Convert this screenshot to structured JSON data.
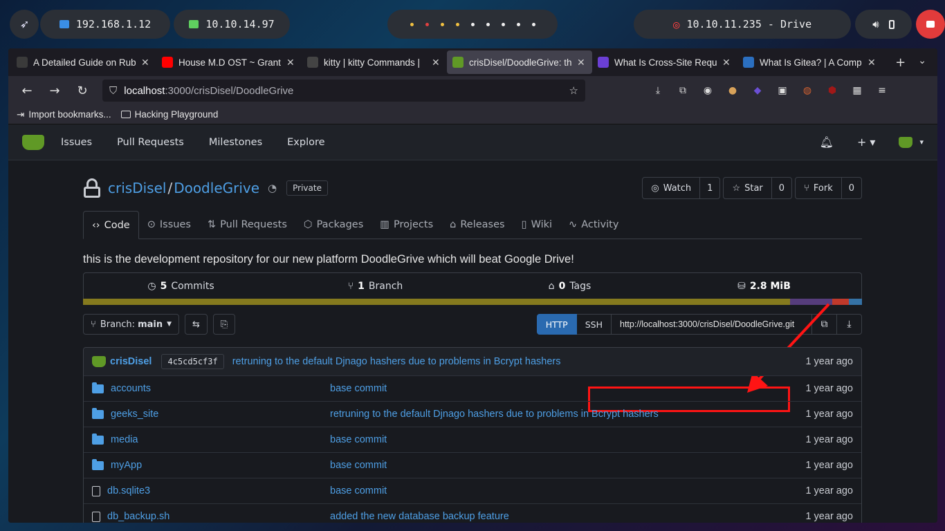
{
  "desktop": {
    "ip_local": "192.168.1.12",
    "ip_vpn": "10.10.14.97",
    "target": "10.10.11.235 - Drive",
    "workspace_dot_colors": [
      "#f0c040",
      "#e04040",
      "#f0c040",
      "#f0c040",
      "#eeeeee",
      "#eeeeee",
      "#eeeeee",
      "#eeeeee",
      "#eeeeee"
    ]
  },
  "browser": {
    "tabs": [
      {
        "title": "A Detailed Guide on Rub",
        "icon": "wordpress-icon",
        "color": "#3a3a3a",
        "active": false
      },
      {
        "title": "House M.D OST ~ Grant",
        "icon": "youtube-icon",
        "color": "#ff0000",
        "active": false
      },
      {
        "title": "kitty | kitty Commands |",
        "icon": "kitty-icon",
        "color": "#444444",
        "active": false
      },
      {
        "title": "crisDisel/DoodleGrive: th",
        "icon": "gitea-icon",
        "color": "#609926",
        "active": true
      },
      {
        "title": "What Is Cross-Site Requ",
        "icon": "s-icon",
        "color": "#6b3fd4",
        "active": false
      },
      {
        "title": "What Is Gitea? | A Comp",
        "icon": "cloud-icon",
        "color": "#2b6fc0",
        "active": false
      }
    ],
    "url_host": "localhost",
    "url_path": ":3000/crisDisel/DoodleGrive",
    "bookmarks": [
      "Import bookmarks...",
      "Hacking Playground"
    ]
  },
  "gitea": {
    "nav": [
      "Issues",
      "Pull Requests",
      "Milestones",
      "Explore"
    ],
    "owner": "crisDisel",
    "repo": "DoodleGrive",
    "visibility": "Private",
    "watch": {
      "label": "Watch",
      "count": "1"
    },
    "star": {
      "label": "Star",
      "count": "0"
    },
    "fork": {
      "label": "Fork",
      "count": "0"
    },
    "tabs": [
      "Code",
      "Issues",
      "Pull Requests",
      "Packages",
      "Projects",
      "Releases",
      "Wiki",
      "Activity"
    ],
    "description": "this is the development repository for our new platform DoodleGrive which will beat Google Drive!",
    "stats": {
      "commits_num": "5",
      "commits_label": "Commits",
      "branch_num": "1",
      "branch_label": "Branch",
      "tags_num": "0",
      "tags_label": "Tags",
      "size": "2.8 MiB"
    },
    "languages": [
      {
        "color": "#857a1e",
        "fraction": 0.908
      },
      {
        "color": "#563d7c",
        "fraction": 0.054
      },
      {
        "color": "#c0392b",
        "fraction": 0.021
      },
      {
        "color": "#3572a5",
        "fraction": 0.017
      }
    ],
    "branch_label": "Branch:",
    "branch_name": "main",
    "clone_http": "HTTP",
    "clone_ssh": "SSH",
    "clone_url": "http://localhost:3000/crisDisel/DoodleGrive.git",
    "latest_commit": {
      "author": "crisDisel",
      "sha": "4c5cd5cf3f",
      "message": "retruning to the default Djnago hashers due to problems in Bcrypt hashers",
      "time": "1 year ago"
    },
    "files": [
      {
        "name": "accounts",
        "type": "dir",
        "message": "base commit",
        "time": "1 year ago"
      },
      {
        "name": "geeks_site",
        "type": "dir",
        "message": "retruning to the default Djnago hashers due to problems in Bcrypt hashers",
        "time": "1 year ago"
      },
      {
        "name": "media",
        "type": "dir",
        "message": "base commit",
        "time": "1 year ago"
      },
      {
        "name": "myApp",
        "type": "dir",
        "message": "base commit",
        "time": "1 year ago"
      },
      {
        "name": "db.sqlite3",
        "type": "file",
        "message": "base commit",
        "time": "1 year ago"
      },
      {
        "name": "db_backup.sh",
        "type": "file",
        "message": "added the new database backup feature",
        "time": "1 year ago"
      }
    ]
  }
}
